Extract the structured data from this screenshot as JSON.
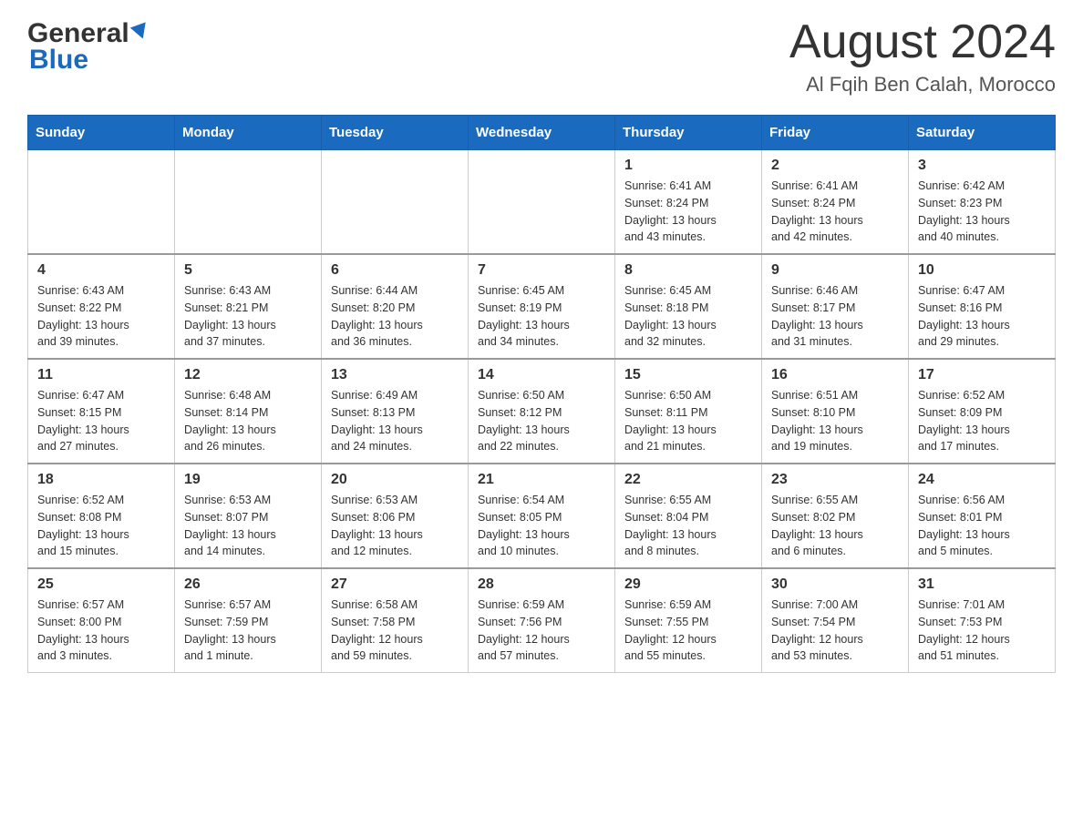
{
  "header": {
    "logo_general": "General",
    "logo_blue": "Blue",
    "month_title": "August 2024",
    "location": "Al Fqih Ben Calah, Morocco"
  },
  "days_of_week": [
    "Sunday",
    "Monday",
    "Tuesday",
    "Wednesday",
    "Thursday",
    "Friday",
    "Saturday"
  ],
  "weeks": [
    {
      "days": [
        {
          "num": "",
          "info": ""
        },
        {
          "num": "",
          "info": ""
        },
        {
          "num": "",
          "info": ""
        },
        {
          "num": "",
          "info": ""
        },
        {
          "num": "1",
          "info": "Sunrise: 6:41 AM\nSunset: 8:24 PM\nDaylight: 13 hours\nand 43 minutes."
        },
        {
          "num": "2",
          "info": "Sunrise: 6:41 AM\nSunset: 8:24 PM\nDaylight: 13 hours\nand 42 minutes."
        },
        {
          "num": "3",
          "info": "Sunrise: 6:42 AM\nSunset: 8:23 PM\nDaylight: 13 hours\nand 40 minutes."
        }
      ]
    },
    {
      "days": [
        {
          "num": "4",
          "info": "Sunrise: 6:43 AM\nSunset: 8:22 PM\nDaylight: 13 hours\nand 39 minutes."
        },
        {
          "num": "5",
          "info": "Sunrise: 6:43 AM\nSunset: 8:21 PM\nDaylight: 13 hours\nand 37 minutes."
        },
        {
          "num": "6",
          "info": "Sunrise: 6:44 AM\nSunset: 8:20 PM\nDaylight: 13 hours\nand 36 minutes."
        },
        {
          "num": "7",
          "info": "Sunrise: 6:45 AM\nSunset: 8:19 PM\nDaylight: 13 hours\nand 34 minutes."
        },
        {
          "num": "8",
          "info": "Sunrise: 6:45 AM\nSunset: 8:18 PM\nDaylight: 13 hours\nand 32 minutes."
        },
        {
          "num": "9",
          "info": "Sunrise: 6:46 AM\nSunset: 8:17 PM\nDaylight: 13 hours\nand 31 minutes."
        },
        {
          "num": "10",
          "info": "Sunrise: 6:47 AM\nSunset: 8:16 PM\nDaylight: 13 hours\nand 29 minutes."
        }
      ]
    },
    {
      "days": [
        {
          "num": "11",
          "info": "Sunrise: 6:47 AM\nSunset: 8:15 PM\nDaylight: 13 hours\nand 27 minutes."
        },
        {
          "num": "12",
          "info": "Sunrise: 6:48 AM\nSunset: 8:14 PM\nDaylight: 13 hours\nand 26 minutes."
        },
        {
          "num": "13",
          "info": "Sunrise: 6:49 AM\nSunset: 8:13 PM\nDaylight: 13 hours\nand 24 minutes."
        },
        {
          "num": "14",
          "info": "Sunrise: 6:50 AM\nSunset: 8:12 PM\nDaylight: 13 hours\nand 22 minutes."
        },
        {
          "num": "15",
          "info": "Sunrise: 6:50 AM\nSunset: 8:11 PM\nDaylight: 13 hours\nand 21 minutes."
        },
        {
          "num": "16",
          "info": "Sunrise: 6:51 AM\nSunset: 8:10 PM\nDaylight: 13 hours\nand 19 minutes."
        },
        {
          "num": "17",
          "info": "Sunrise: 6:52 AM\nSunset: 8:09 PM\nDaylight: 13 hours\nand 17 minutes."
        }
      ]
    },
    {
      "days": [
        {
          "num": "18",
          "info": "Sunrise: 6:52 AM\nSunset: 8:08 PM\nDaylight: 13 hours\nand 15 minutes."
        },
        {
          "num": "19",
          "info": "Sunrise: 6:53 AM\nSunset: 8:07 PM\nDaylight: 13 hours\nand 14 minutes."
        },
        {
          "num": "20",
          "info": "Sunrise: 6:53 AM\nSunset: 8:06 PM\nDaylight: 13 hours\nand 12 minutes."
        },
        {
          "num": "21",
          "info": "Sunrise: 6:54 AM\nSunset: 8:05 PM\nDaylight: 13 hours\nand 10 minutes."
        },
        {
          "num": "22",
          "info": "Sunrise: 6:55 AM\nSunset: 8:04 PM\nDaylight: 13 hours\nand 8 minutes."
        },
        {
          "num": "23",
          "info": "Sunrise: 6:55 AM\nSunset: 8:02 PM\nDaylight: 13 hours\nand 6 minutes."
        },
        {
          "num": "24",
          "info": "Sunrise: 6:56 AM\nSunset: 8:01 PM\nDaylight: 13 hours\nand 5 minutes."
        }
      ]
    },
    {
      "days": [
        {
          "num": "25",
          "info": "Sunrise: 6:57 AM\nSunset: 8:00 PM\nDaylight: 13 hours\nand 3 minutes."
        },
        {
          "num": "26",
          "info": "Sunrise: 6:57 AM\nSunset: 7:59 PM\nDaylight: 13 hours\nand 1 minute."
        },
        {
          "num": "27",
          "info": "Sunrise: 6:58 AM\nSunset: 7:58 PM\nDaylight: 12 hours\nand 59 minutes."
        },
        {
          "num": "28",
          "info": "Sunrise: 6:59 AM\nSunset: 7:56 PM\nDaylight: 12 hours\nand 57 minutes."
        },
        {
          "num": "29",
          "info": "Sunrise: 6:59 AM\nSunset: 7:55 PM\nDaylight: 12 hours\nand 55 minutes."
        },
        {
          "num": "30",
          "info": "Sunrise: 7:00 AM\nSunset: 7:54 PM\nDaylight: 12 hours\nand 53 minutes."
        },
        {
          "num": "31",
          "info": "Sunrise: 7:01 AM\nSunset: 7:53 PM\nDaylight: 12 hours\nand 51 minutes."
        }
      ]
    }
  ]
}
